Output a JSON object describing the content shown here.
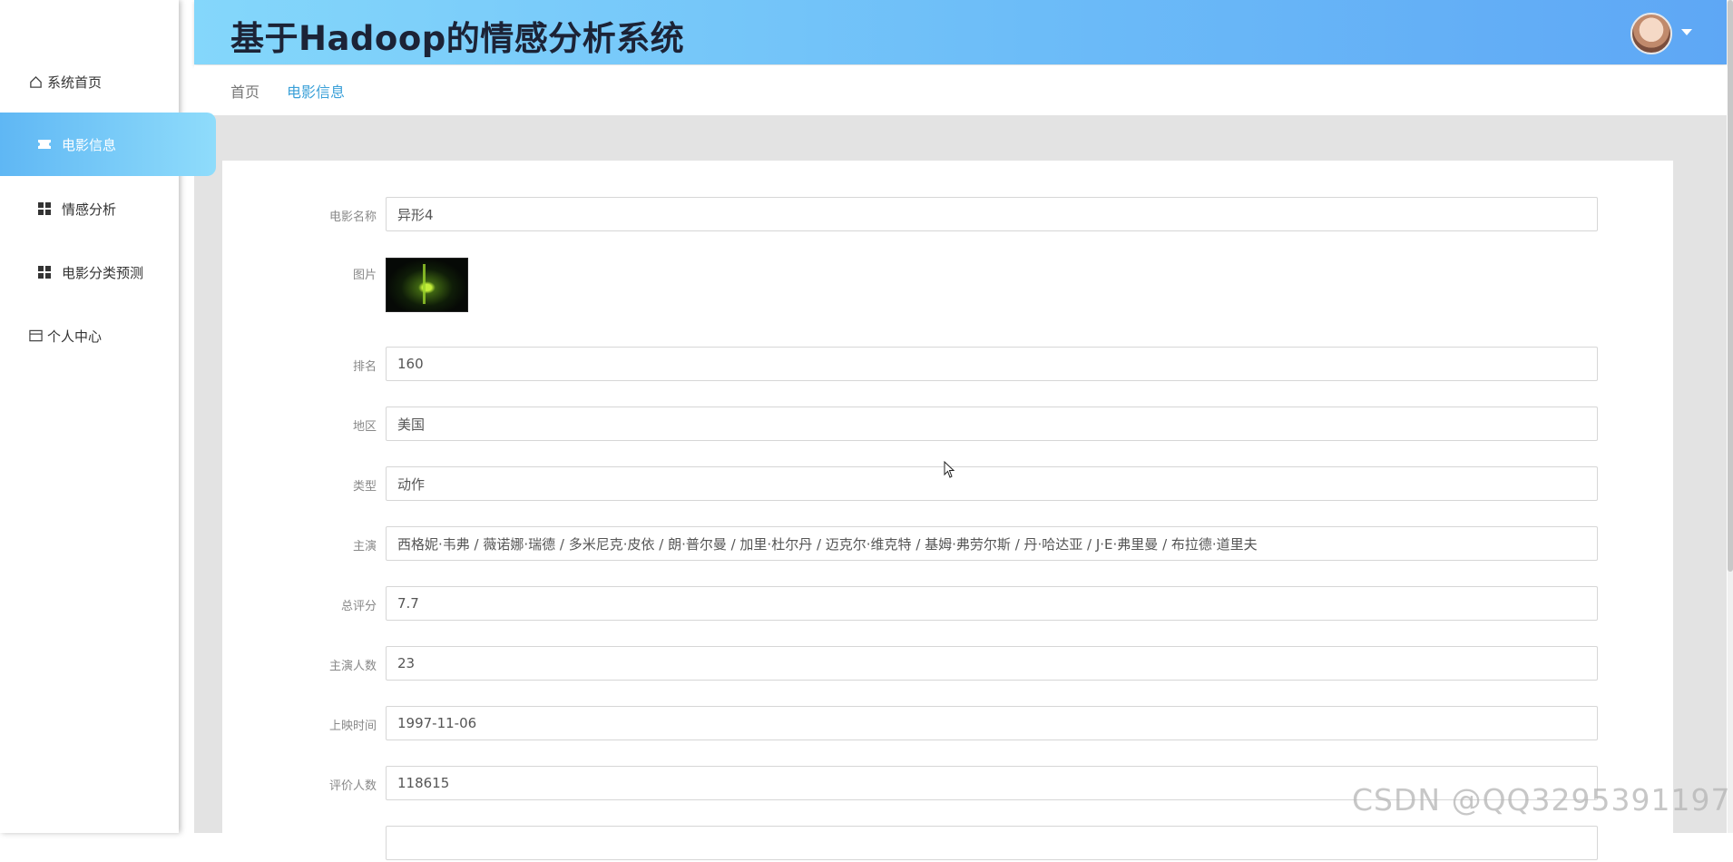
{
  "app": {
    "title": "基于Hadoop的情感分析系统"
  },
  "sidebar": {
    "items": [
      {
        "label": "系统首页",
        "icon": "home-icon"
      },
      {
        "label": "电影信息",
        "icon": "ticket-icon",
        "active": true
      },
      {
        "label": "情感分析",
        "icon": "grid-icon"
      },
      {
        "label": "电影分类预测",
        "icon": "grid-icon"
      },
      {
        "label": "个人中心",
        "icon": "card-icon"
      }
    ]
  },
  "breadcrumb": {
    "home": "首页",
    "current": "电影信息"
  },
  "form": {
    "name_label": "电影名称",
    "name_value": "异形4",
    "image_label": "图片",
    "rank_label": "排名",
    "rank_value": "160",
    "region_label": "地区",
    "region_value": "美国",
    "genre_label": "类型",
    "genre_value": "动作",
    "cast_label": "主演",
    "cast_value": "西格妮·韦弗 / 薇诺娜·瑞德 / 多米尼克·皮依 / 朗·普尔曼 / 加里·杜尔丹 / 迈克尔·维克特 / 基姆·弗劳尔斯 / 丹·哈达亚 / J·E·弗里曼 / 布拉德·道里夫",
    "score_label": "总评分",
    "score_value": "7.7",
    "cast_count_label": "主演人数",
    "cast_count_value": "23",
    "release_label": "上映时间",
    "release_value": "1997-11-06",
    "reviews_label": "评价人数",
    "reviews_value": "118615"
  },
  "watermark": "CSDN @QQ3295391197",
  "colors": {
    "header_start": "#84d7fb",
    "header_end": "#5ea7f5",
    "active_nav": "#5fb7f4",
    "breadcrumb_active": "#3aa0d8"
  }
}
